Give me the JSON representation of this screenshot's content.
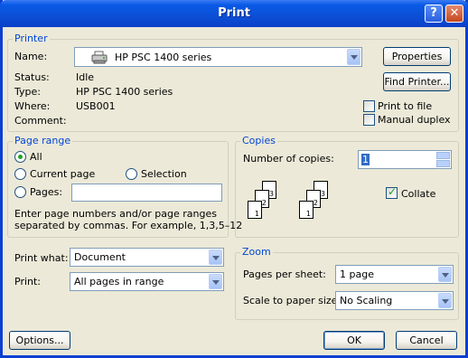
{
  "window": {
    "title": "Print",
    "help_glyph": "?",
    "close_glyph": "✕"
  },
  "printer": {
    "legend": "Printer",
    "name_label": "Name:",
    "name_value": "HP PSC 1400 series",
    "status_label": "Status:",
    "status_value": "Idle",
    "type_label": "Type:",
    "type_value": "HP PSC 1400 series",
    "where_label": "Where:",
    "where_value": "USB001",
    "comment_label": "Comment:",
    "comment_value": "",
    "properties_button": "Properties",
    "find_printer_button": "Find Printer...",
    "print_to_file_label": "Print to file",
    "print_to_file_checked": false,
    "manual_duplex_label": "Manual duplex",
    "manual_duplex_checked": false
  },
  "page_range": {
    "legend": "Page range",
    "all_label": "All",
    "current_page_label": "Current page",
    "selection_label": "Selection",
    "pages_label": "Pages:",
    "pages_value": "",
    "selected": "All",
    "hint_line1": "Enter page numbers and/or page ranges",
    "hint_line2": "separated by commas.  For example, 1,3,5–12"
  },
  "copies": {
    "legend": "Copies",
    "number_label": "Number of copies:",
    "number_value": "1",
    "collate_label": "Collate",
    "collate_checked": true,
    "page_numbers": [
      "1",
      "2",
      "3"
    ]
  },
  "print_what": {
    "label": "Print what:",
    "value": "Document"
  },
  "print": {
    "label": "Print:",
    "value": "All pages in range"
  },
  "zoom": {
    "legend": "Zoom",
    "pages_per_sheet_label": "Pages per sheet:",
    "pages_per_sheet_value": "1 page",
    "scale_label": "Scale to paper size:",
    "scale_value": "No Scaling"
  },
  "buttons": {
    "options": "Options...",
    "ok": "OK",
    "cancel": "Cancel"
  },
  "colors": {
    "title_bar": "#0a4fd6",
    "group_legend": "#0046d5",
    "dialog_bg": "#ece9d8",
    "check_mark": "#21a121"
  }
}
